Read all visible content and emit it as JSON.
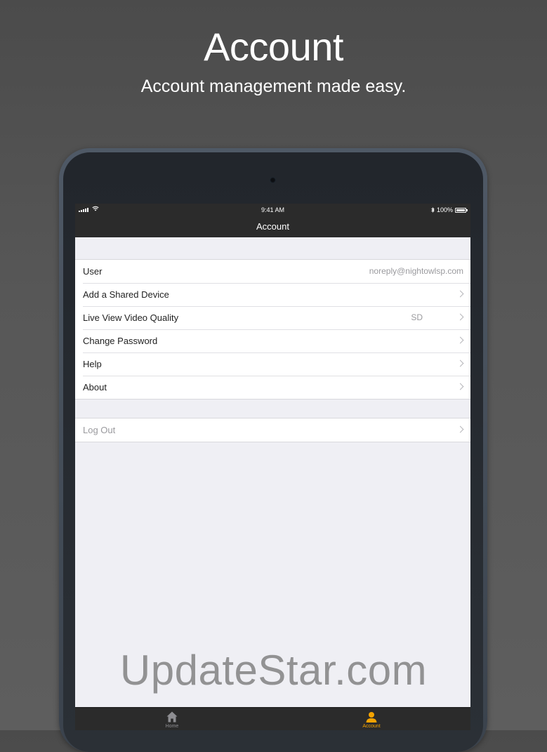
{
  "hero": {
    "title": "Account",
    "subtitle": "Account management made easy."
  },
  "status_bar": {
    "time": "9:41 AM",
    "battery": "100%",
    "icons": [
      "signal-icon",
      "wifi-icon",
      "bluetooth-icon",
      "battery-icon"
    ]
  },
  "navbar": {
    "title": "Account"
  },
  "settings": {
    "user": {
      "label": "User",
      "value": "noreply@nightowlsp.com"
    },
    "add_shared_device": {
      "label": "Add a Shared Device"
    },
    "video_quality": {
      "label": "Live View Video Quality",
      "value": "SD"
    },
    "change_password": {
      "label": "Change Password"
    },
    "help": {
      "label": "Help"
    },
    "about": {
      "label": "About"
    },
    "logout": {
      "label": "Log Out"
    }
  },
  "tabbar": {
    "home": {
      "label": "Home",
      "icon": "home-icon"
    },
    "account": {
      "label": "Account",
      "icon": "person-icon"
    },
    "active_color": "#f5a300"
  },
  "watermark": "UpdateStar.com",
  "colors": {
    "background": "#555555",
    "bars": "#2b2b2b",
    "screen_bg": "#efeff4",
    "accent": "#f5a300"
  }
}
